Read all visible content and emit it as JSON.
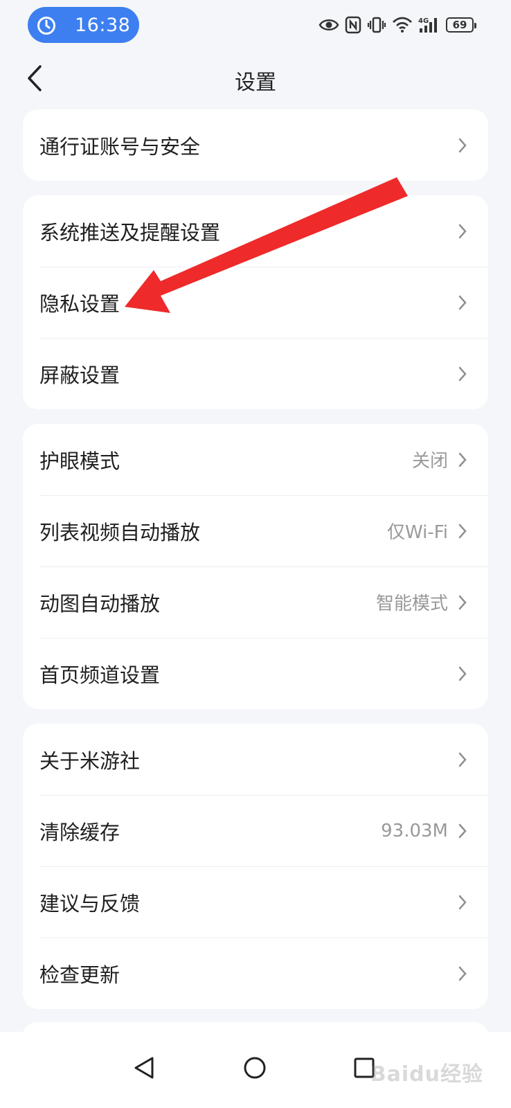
{
  "status_bar": {
    "time": "16:38",
    "battery": "69",
    "icons": [
      "timer-icon",
      "eye-icon",
      "nfc-icon",
      "vibrate-icon",
      "wifi-icon",
      "cellular-4g-icon",
      "battery-icon"
    ]
  },
  "header": {
    "title": "设置"
  },
  "groups": [
    {
      "items": [
        {
          "label": "通行证账号与安全",
          "value": ""
        }
      ]
    },
    {
      "items": [
        {
          "label": "系统推送及提醒设置",
          "value": ""
        },
        {
          "label": "隐私设置",
          "value": ""
        },
        {
          "label": "屏蔽设置",
          "value": ""
        }
      ]
    },
    {
      "items": [
        {
          "label": "护眼模式",
          "value": "关闭"
        },
        {
          "label": "列表视频自动播放",
          "value": "仅Wi-Fi"
        },
        {
          "label": "动图自动播放",
          "value": "智能模式"
        },
        {
          "label": "首页频道设置",
          "value": ""
        }
      ]
    },
    {
      "items": [
        {
          "label": "关于米游社",
          "value": ""
        },
        {
          "label": "清除缓存",
          "value": "93.03M"
        },
        {
          "label": "建议与反馈",
          "value": ""
        },
        {
          "label": "检查更新",
          "value": ""
        }
      ]
    }
  ],
  "bottom_nav": [
    "back-triangle-icon",
    "home-circle-icon",
    "recents-square-icon"
  ],
  "watermark": "Baidu经验",
  "colors": {
    "accent": "#3d7ff0",
    "annotation_arrow": "#ee2a2a",
    "background": "#f4f6f9"
  }
}
